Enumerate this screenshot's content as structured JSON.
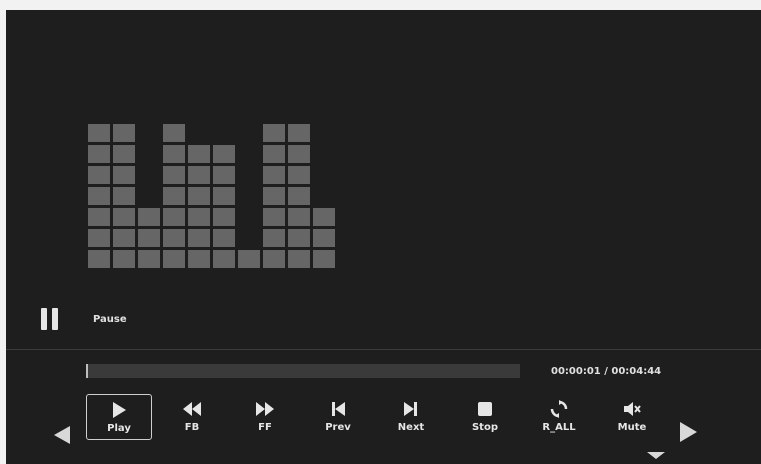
{
  "visualizer": {
    "levels": [
      7,
      7,
      3,
      7,
      6,
      6,
      1,
      7,
      7,
      3
    ]
  },
  "status": {
    "state_icon": "pause-icon",
    "label": "Pause"
  },
  "playback": {
    "progress": 0.004,
    "time_text": "00:00:01 / 00:04:44"
  },
  "controls": [
    {
      "label": "Play",
      "icon": "play-icon",
      "selected": true
    },
    {
      "label": "FB",
      "icon": "fast-backward-icon"
    },
    {
      "label": "FF",
      "icon": "fast-forward-icon"
    },
    {
      "label": "Prev",
      "icon": "previous-icon"
    },
    {
      "label": "Next",
      "icon": "next-icon"
    },
    {
      "label": "Stop",
      "icon": "stop-icon"
    },
    {
      "label": "R_ALL",
      "icon": "repeat-all-icon"
    },
    {
      "label": "Mute",
      "icon": "mute-icon"
    }
  ],
  "nav": {
    "left": "arrow-left-icon",
    "right": "arrow-right-icon",
    "down": "arrow-down-icon"
  }
}
